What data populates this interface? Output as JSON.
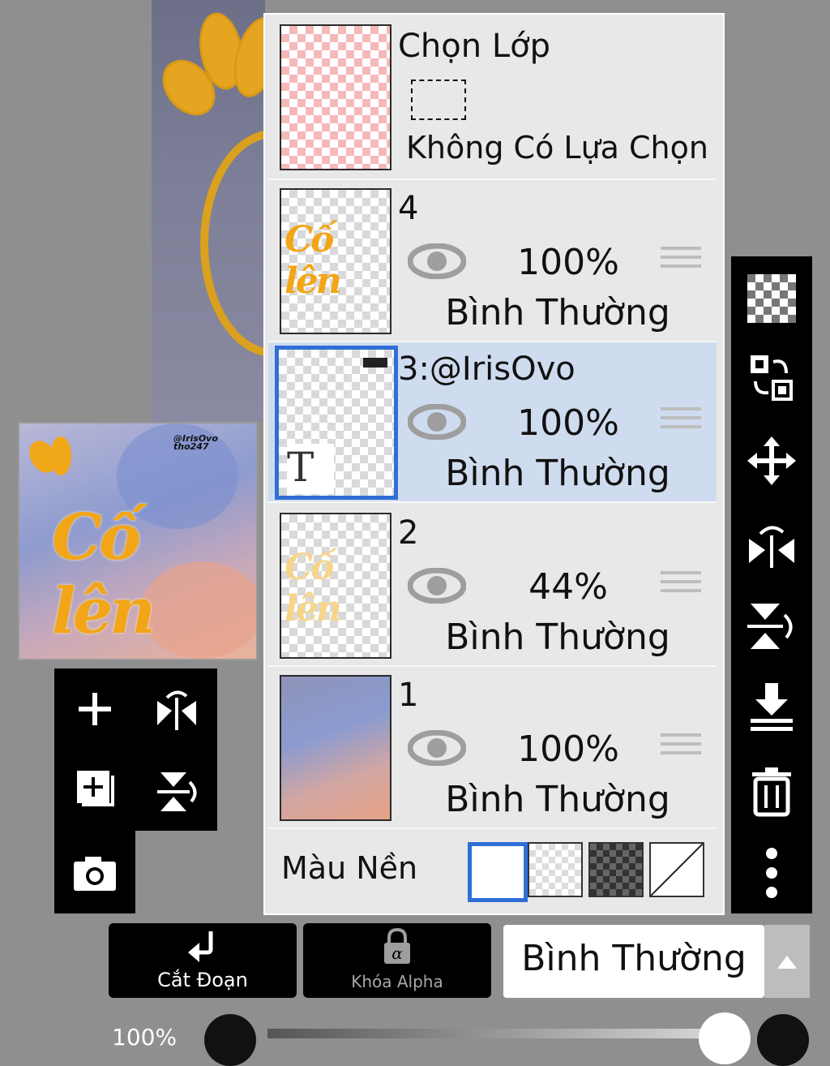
{
  "colors": {
    "panel_bg": "#e8e8e8",
    "selected_row_bg": "#cfdcef",
    "accent_blue": "#2f6fd6",
    "toolbar_bg": "#000000",
    "art_orange": "#f2a516"
  },
  "layer_panel": {
    "selection": {
      "title": "Chọn Lớp",
      "status": "Không Có Lựa Chọn"
    },
    "layers": [
      {
        "name": "4",
        "opacity": "100%",
        "mode": "Bình Thường",
        "visible": true,
        "selected": false,
        "thumb_text": "Cố lên"
      },
      {
        "name": "3:@IrisOvo",
        "opacity": "100%",
        "mode": "Bình Thường",
        "visible": true,
        "selected": true,
        "type_glyph": "T"
      },
      {
        "name": "2",
        "opacity": "44%",
        "mode": "Bình Thường",
        "visible": true,
        "selected": false,
        "thumb_text": "Cố lên"
      },
      {
        "name": "1",
        "opacity": "100%",
        "mode": "Bình Thường",
        "visible": true,
        "selected": false
      }
    ],
    "background": {
      "label": "Màu Nền",
      "options": [
        "white",
        "transparent",
        "dark-checker",
        "none"
      ],
      "selected": "white"
    }
  },
  "preview": {
    "art_text": "Cố lên",
    "watermark": "@IrisOvo\ntho247"
  },
  "left_tools": [
    "add-layer-icon",
    "flip-horizontal-icon",
    "add-layer-copy-icon",
    "flip-vertical-icon",
    "camera-icon"
  ],
  "right_tools": [
    "transparency-icon",
    "swap-layer-icon",
    "move-icon",
    "flip-horizontal-icon",
    "flip-vertical-icon",
    "merge-down-icon",
    "delete-icon",
    "more-icon"
  ],
  "bottom": {
    "clip_label": "Cắt Đoạn",
    "alpha_label": "Khóa Alpha",
    "blend_mode": "Bình Thường",
    "opacity_label": "100%"
  }
}
